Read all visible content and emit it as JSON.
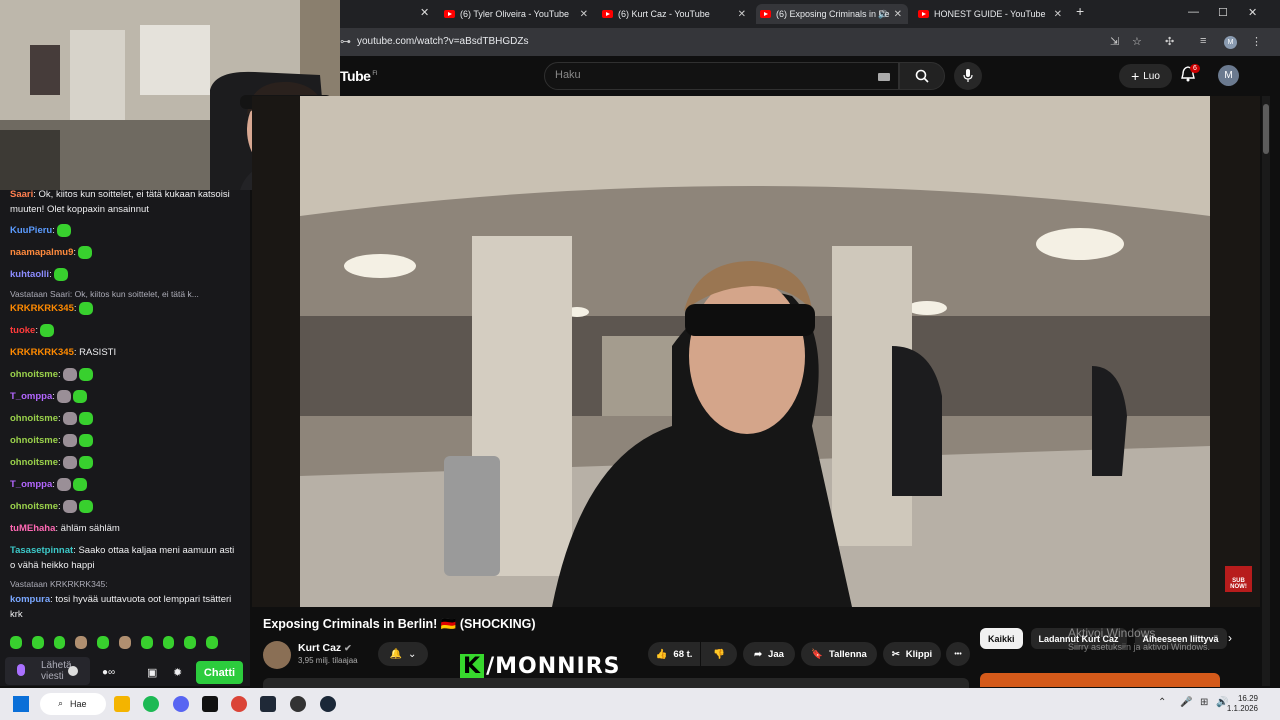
{
  "browser": {
    "tabs": [
      {
        "label": "(6) Tyler Oliveira - YouTube"
      },
      {
        "label": "(6) Kurt Caz - YouTube"
      },
      {
        "label": "(6) Exposing Criminals in Be"
      },
      {
        "label": "HONEST GUIDE - YouTube"
      }
    ],
    "new_tab": "+",
    "url": "youtube.com/watch?v=aBsdTBHGDZs"
  },
  "youtube": {
    "logo": "Tube",
    "logo_region": "FI",
    "search_placeholder": "Haku",
    "create_label": "Luo",
    "notification_count": "6",
    "avatar_letter": "M"
  },
  "video": {
    "title": "Exposing Criminals in Berlin! 🇩🇪 (SHOCKING)",
    "channel": "Kurt Caz",
    "subscribers": "3,95 milj. tilaajaa",
    "likes": "68 t.",
    "share_label": "Jaa",
    "save_label": "Tallenna",
    "clip_label": "Klippi",
    "more": "•••",
    "corner_badge": "SUB NOW!"
  },
  "chips": [
    "Kaikki",
    "Ladannut Kurt Caz",
    "Aiheeseen liittyvä"
  ],
  "windows_watermark": {
    "line1": "Aktivoi Windows",
    "line2": "Siirry asetuksiin ja aktivoi Windows."
  },
  "overlay_logo": {
    "k": "K",
    "rest": "/MONNIRS"
  },
  "chat": {
    "messages": [
      {
        "user": "Saari",
        "color": "#ff7f50",
        "text": ": Ok, kiitos kun soittelet, ei tätä kukaan katsoisi muuten! Olet koppaxin ansainnut"
      },
      {
        "user": "KuuPieru",
        "color": "#5b9bff",
        "text": ":"
      },
      {
        "user": "naamapalmu9",
        "color": "#ff8a3d",
        "text": ":"
      },
      {
        "user": "kuhtaolli",
        "color": "#8c8cff",
        "text": ":"
      },
      {
        "reply": "Vastataan Saari: Ok, kiitos kun soittelet, ei tätä k..."
      },
      {
        "user": "KRKRKRK345",
        "color": "#ff8a00",
        "text": ":"
      },
      {
        "user": "tuoke",
        "color": "#ff3b3b",
        "text": ":"
      },
      {
        "user": "KRKRKRK345",
        "color": "#ff8a00",
        "text": ": RASISTI"
      },
      {
        "user": "ohnoitsme",
        "color": "#9ad14b",
        "text": ":"
      },
      {
        "user": "T_omppa",
        "color": "#b366ff",
        "text": ":"
      },
      {
        "user": "ohnoitsme",
        "color": "#9ad14b",
        "text": ":"
      },
      {
        "user": "ohnoitsme",
        "color": "#9ad14b",
        "text": ":"
      },
      {
        "user": "ohnoitsme",
        "color": "#9ad14b",
        "text": ":"
      },
      {
        "user": "T_omppa",
        "color": "#b366ff",
        "text": ":"
      },
      {
        "user": "ohnoitsme",
        "color": "#9ad14b",
        "text": ":"
      },
      {
        "user": "tuMEhaha",
        "color": "#ff69b4",
        "text": ": ähläm sähläm"
      },
      {
        "user": "Tasasetpinnat",
        "color": "#3cc8c8",
        "text": ": Saako ottaa kaljaa meni aamuun asti o vähä heikko happi"
      },
      {
        "reply": "Vastataan KRKRKRK345:"
      },
      {
        "user": "kompura",
        "color": "#7aa7ff",
        "text": ": tosi hyvää uuttavuota oot lemppari tsätteri krk"
      }
    ],
    "input_placeholder": "Lähetä viesti",
    "send_label": "Chatti"
  },
  "taskbar": {
    "search_label": "Hae",
    "time": "16.29",
    "date": "1.1.2026"
  },
  "colors": {
    "accent_green": "#2ccc3d",
    "yt_red": "#ff0000"
  }
}
